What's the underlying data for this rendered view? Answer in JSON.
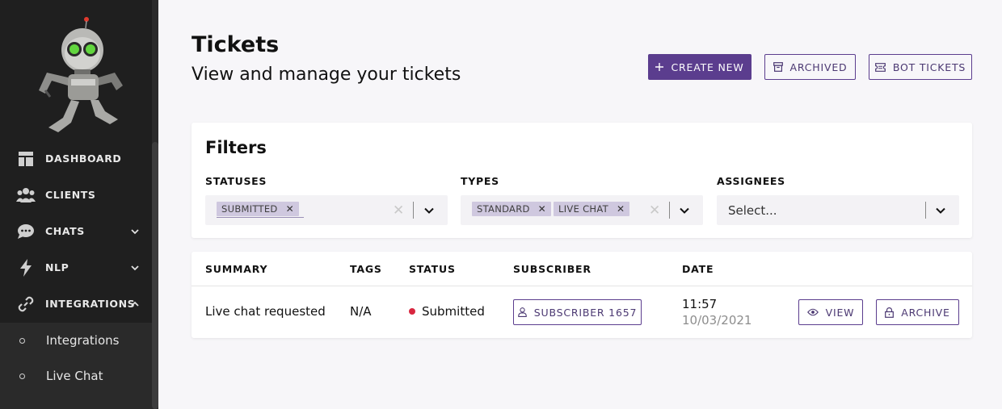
{
  "colors": {
    "accent": "#5b3d8e",
    "sidebar_bg": "#1f1f1f",
    "chip_bg": "#cfc8df",
    "status_submitted": "#d8263f"
  },
  "sidebar": {
    "logo_icon": "robot-mascot-icon",
    "items": [
      {
        "label": "DASHBOARD",
        "icon": "dashboard-icon"
      },
      {
        "label": "CLIENTS",
        "icon": "users-icon"
      },
      {
        "label": "CHATS",
        "icon": "chat-bubble-icon",
        "chevron": "down"
      },
      {
        "label": "NLP",
        "icon": "lightning-icon",
        "chevron": "down"
      },
      {
        "label": "INTEGRATIONS",
        "icon": "link-icon",
        "chevron": "up"
      }
    ],
    "subitems": [
      {
        "label": "Integrations"
      },
      {
        "label": "Live Chat"
      }
    ]
  },
  "header": {
    "title": "Tickets",
    "subtitle": "View and manage your tickets",
    "create_label": "CREATE NEW",
    "archived_label": "ARCHIVED",
    "bot_tickets_label": "BOT TICKETS"
  },
  "filters": {
    "title": "Filters",
    "statuses": {
      "label": "STATUSES",
      "chips": [
        "SUBMITTED"
      ]
    },
    "types": {
      "label": "TYPES",
      "chips": [
        "STANDARD",
        "LIVE CHAT"
      ]
    },
    "assignees": {
      "label": "ASSIGNEES",
      "placeholder": "Select..."
    }
  },
  "table": {
    "columns": [
      "SUMMARY",
      "TAGS",
      "STATUS",
      "SUBSCRIBER",
      "DATE"
    ],
    "rows": [
      {
        "summary": "Live chat requested",
        "tags": "N/A",
        "status": "Submitted",
        "subscriber": "SUBSCRIBER 1657",
        "time": "11:57",
        "date": "10/03/2021",
        "view_label": "VIEW",
        "archive_label": "ARCHIVE"
      }
    ]
  }
}
